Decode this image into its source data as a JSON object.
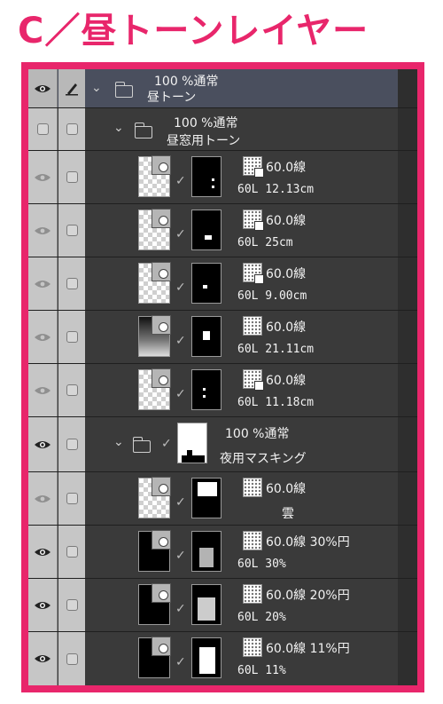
{
  "title": "C／昼トーンレイヤー",
  "icons": {
    "eye": "eye-icon",
    "pen": "pen-icon",
    "folder": "folder-icon",
    "chevron": "chevron-down-icon",
    "check": "check-icon",
    "tone": "tone-icon"
  },
  "colors": {
    "accent": "#e8266b",
    "panel": "#3a3a3a",
    "selected": "#4a4f5e"
  },
  "layers": [
    {
      "opacity_blend": "100 %通常",
      "name": "昼トーン"
    },
    {
      "opacity_blend": "100 %通常",
      "name": "昼窓用トーン"
    },
    {
      "tone": "60.0線",
      "info": "60L 12.13cm"
    },
    {
      "tone": "60.0線",
      "info": "60L 25cm"
    },
    {
      "tone": "60.0線",
      "info": "60L 9.00cm"
    },
    {
      "tone": "60.0線",
      "info": "60L 21.11cm"
    },
    {
      "tone": "60.0線",
      "info": "60L 11.18cm"
    },
    {
      "opacity_blend": "100 %通常",
      "name": "夜用マスキング"
    },
    {
      "tone": "60.0線",
      "info": "雲"
    },
    {
      "tone": "60.0線 30%円",
      "info": "60L 30%"
    },
    {
      "tone": "60.0線 20%円",
      "info": "60L 20%"
    },
    {
      "tone": "60.0線 11%円",
      "info": "60L 11%"
    }
  ]
}
